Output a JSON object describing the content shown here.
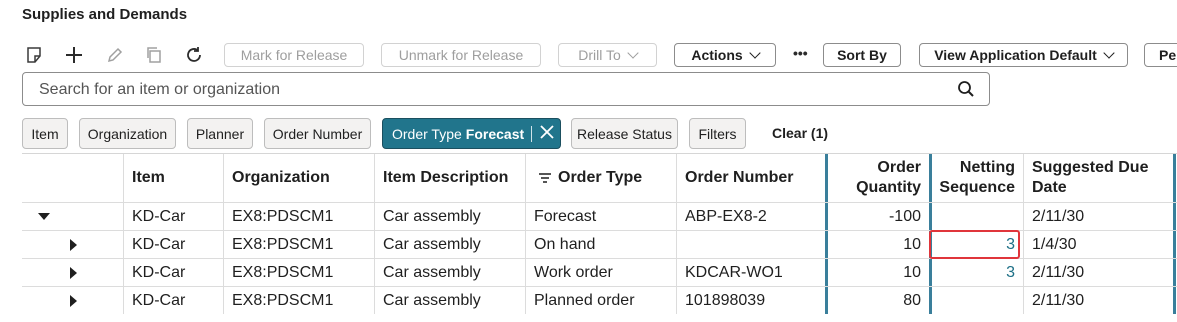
{
  "page": {
    "title": "Supplies and Demands"
  },
  "toolbar": {
    "icons": [
      "note-icon",
      "add-icon",
      "edit-icon",
      "duplicate-icon",
      "refresh-icon"
    ],
    "mark_for_release": "Mark for Release",
    "unmark_for_release": "Unmark for Release",
    "drill_to": "Drill To",
    "actions": "Actions",
    "more": "•••",
    "sort_by": "Sort By",
    "view": "View Application Default",
    "overflow": "Pe"
  },
  "search": {
    "placeholder": "Search for an item or organization",
    "value": ""
  },
  "filters": {
    "item": "Item",
    "organization": "Organization",
    "planner": "Planner",
    "order_number": "Order Number",
    "order_type_label": "Order Type",
    "order_type_value": "Forecast",
    "release_status": "Release Status",
    "filters": "Filters",
    "clear": "Clear (1)"
  },
  "table": {
    "headers": {
      "item": "Item",
      "organization": "Organization",
      "item_description": "Item Description",
      "order_type": "Order Type",
      "order_number": "Order Number",
      "order_quantity_1": "Order",
      "order_quantity_2": "Quantity",
      "netting_sequence_1": "Netting",
      "netting_sequence_2": "Sequence",
      "suggested_due_date_1": "Suggested Due",
      "suggested_due_date_2": "Date"
    },
    "rows": [
      {
        "expanded": true,
        "item": "KD-Car",
        "organization": "EX8:PDSCM1",
        "item_description": "Car assembly",
        "order_type": "Forecast",
        "order_number": "ABP-EX8-2",
        "order_quantity": "-100",
        "netting_sequence": "",
        "suggested_due_date": "2/11/30"
      },
      {
        "expanded": false,
        "item": "KD-Car",
        "organization": "EX8:PDSCM1",
        "item_description": "Car assembly",
        "order_type": "On hand",
        "order_number": "",
        "order_quantity": "10",
        "netting_sequence": "3",
        "suggested_due_date": "1/4/30"
      },
      {
        "expanded": false,
        "item": "KD-Car",
        "organization": "EX8:PDSCM1",
        "item_description": "Car assembly",
        "order_type": "Work order",
        "order_number": "KDCAR-WO1",
        "order_quantity": "10",
        "netting_sequence": "3",
        "suggested_due_date": "2/11/30"
      },
      {
        "expanded": false,
        "item": "KD-Car",
        "organization": "EX8:PDSCM1",
        "item_description": "Car assembly",
        "order_type": "Planned order",
        "order_number": "101898039",
        "order_quantity": "80",
        "netting_sequence": "",
        "suggested_due_date": "2/11/30"
      }
    ]
  },
  "colors": {
    "accent": "#21758c",
    "link": "#1c6f86",
    "highlight_border": "#e0353b",
    "column_divider": "#3a7f9b"
  }
}
